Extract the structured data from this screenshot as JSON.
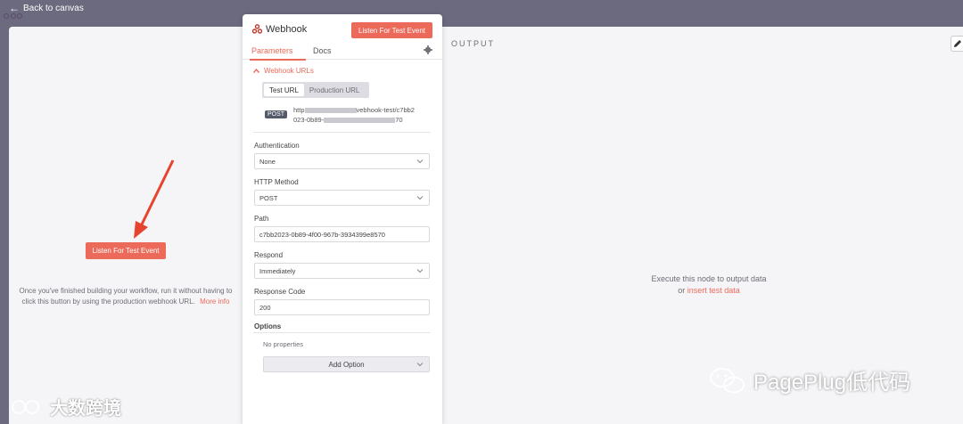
{
  "topbar": {
    "back_label": "Back to canvas"
  },
  "left_panel": {
    "listen_button": "Listen For Test Event",
    "note_text": "Once you've finished building your workflow, run it without having to click this button by using the production webhook URL.",
    "more_info": "More info"
  },
  "node": {
    "title": "Webhook",
    "listen_button": "Listen For Test Event",
    "tabs": [
      "Parameters",
      "Docs"
    ],
    "webhook_urls_label": "Webhook URLs",
    "url_tabs": [
      "Test URL",
      "Production URL"
    ],
    "method_badge": "POST",
    "url_start": "http",
    "url_mid": "vebhook-test/c7bb2",
    "url_line2_start": "023-0b89-",
    "url_line2_end": "70",
    "fields": {
      "authentication": {
        "label": "Authentication",
        "value": "None"
      },
      "http_method": {
        "label": "HTTP Method",
        "value": "POST"
      },
      "path": {
        "label": "Path",
        "value": "c7bb2023-0b89-4f00-967b-3934399e8570"
      },
      "respond": {
        "label": "Respond",
        "value": "Immediately"
      },
      "response_code": {
        "label": "Response Code",
        "value": "200"
      }
    },
    "options_label": "Options",
    "no_properties": "No properties",
    "add_option": "Add Option"
  },
  "output": {
    "title": "OUTPUT",
    "message_line1": "Execute this node to output data",
    "message_or": "or",
    "insert_link": "insert test data"
  },
  "watermarks": {
    "left": "大数跨境",
    "right": "PagePlug低代码"
  },
  "colors": {
    "accent": "#ec6a5a",
    "canvas_bg": "#6b6a7e",
    "panel_bg": "#f5f5f7"
  },
  "icons": [
    "arrow-left-icon",
    "webhook-icon",
    "gear-icon",
    "chevron-up-icon",
    "chevron-down-icon",
    "pencil-icon",
    "wechat-icon"
  ]
}
